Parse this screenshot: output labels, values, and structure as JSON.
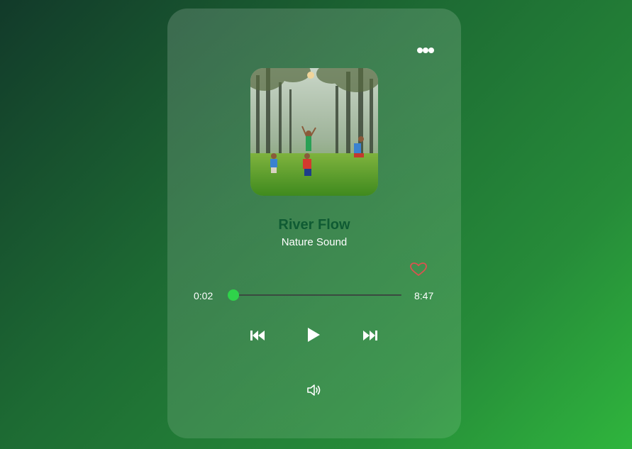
{
  "track": {
    "title": "River Flow",
    "artist": "Nature Sound",
    "current_time": "0:02",
    "duration": "8:47",
    "progress": 0.004,
    "liked": false
  },
  "album_art": {
    "description_icon": "children-playing-in-forest-image"
  },
  "controls": {
    "more": "more-options-icon",
    "prev": "skip-previous-icon",
    "play": "play-icon",
    "next": "skip-next-icon",
    "volume": "volume-icon",
    "like": "heart-icon"
  },
  "colors": {
    "accent": "#2fd34a",
    "title": "#0f5b33",
    "heart": "#d9534f",
    "track": "#3a4a40"
  }
}
